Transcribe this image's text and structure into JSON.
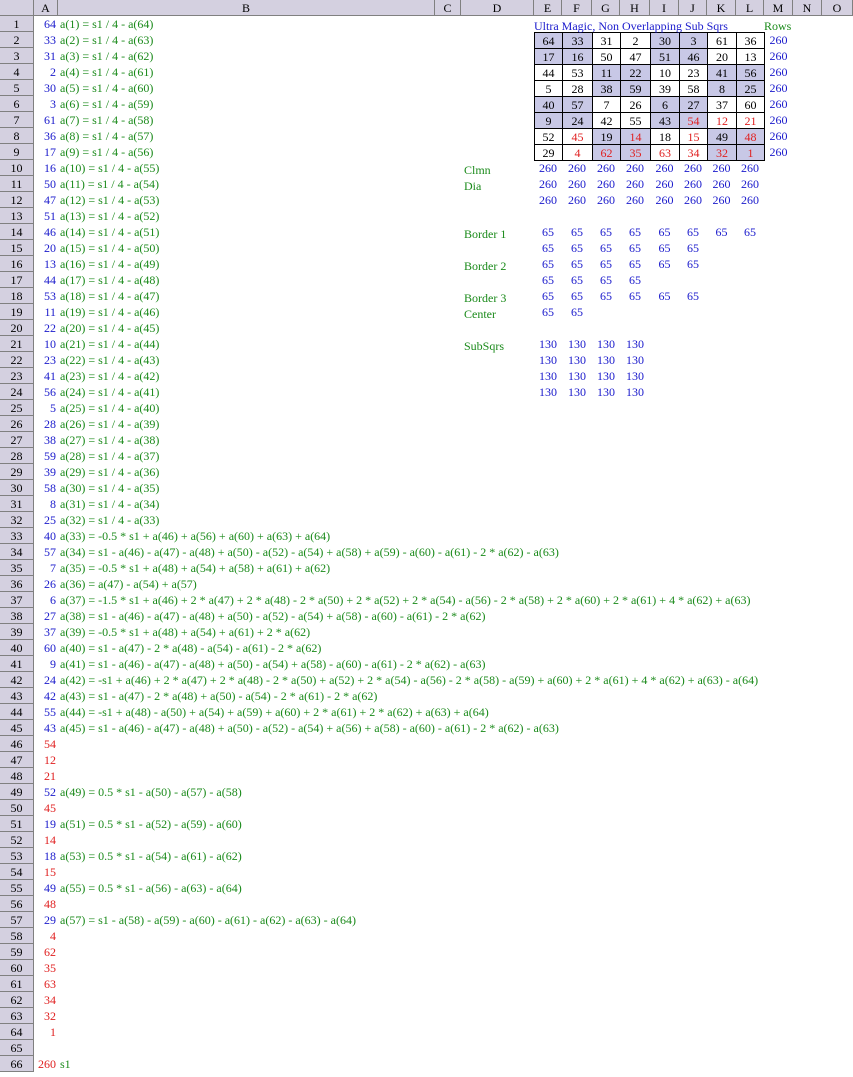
{
  "columns": [
    "A",
    "B",
    "C",
    "D",
    "E",
    "F",
    "G",
    "H",
    "I",
    "J",
    "K",
    "L",
    "M",
    "N",
    "O"
  ],
  "rows": [
    "1",
    "2",
    "3",
    "4",
    "5",
    "6",
    "7",
    "8",
    "9",
    "10",
    "11",
    "12",
    "13",
    "14",
    "15",
    "16",
    "17",
    "18",
    "19",
    "20",
    "21",
    "22",
    "23",
    "24",
    "25",
    "26",
    "27",
    "28",
    "29",
    "30",
    "31",
    "32",
    "33",
    "34",
    "35",
    "36",
    "37",
    "38",
    "39",
    "40",
    "41",
    "42",
    "43",
    "44",
    "45",
    "46",
    "47",
    "48",
    "49",
    "50",
    "51",
    "52",
    "53",
    "54",
    "55",
    "56",
    "57",
    "58",
    "59",
    "60",
    "61",
    "62",
    "63",
    "64",
    "65",
    "66"
  ],
  "colA": [
    {
      "v": "64",
      "c": "blue"
    },
    {
      "v": "33",
      "c": "blue"
    },
    {
      "v": "31",
      "c": "blue"
    },
    {
      "v": "2",
      "c": "blue"
    },
    {
      "v": "30",
      "c": "blue"
    },
    {
      "v": "3",
      "c": "blue"
    },
    {
      "v": "61",
      "c": "blue"
    },
    {
      "v": "36",
      "c": "blue"
    },
    {
      "v": "17",
      "c": "blue"
    },
    {
      "v": "16",
      "c": "blue"
    },
    {
      "v": "50",
      "c": "blue"
    },
    {
      "v": "47",
      "c": "blue"
    },
    {
      "v": "51",
      "c": "blue"
    },
    {
      "v": "46",
      "c": "blue"
    },
    {
      "v": "20",
      "c": "blue"
    },
    {
      "v": "13",
      "c": "blue"
    },
    {
      "v": "44",
      "c": "blue"
    },
    {
      "v": "53",
      "c": "blue"
    },
    {
      "v": "11",
      "c": "blue"
    },
    {
      "v": "22",
      "c": "blue"
    },
    {
      "v": "10",
      "c": "blue"
    },
    {
      "v": "23",
      "c": "blue"
    },
    {
      "v": "41",
      "c": "blue"
    },
    {
      "v": "56",
      "c": "blue"
    },
    {
      "v": "5",
      "c": "blue"
    },
    {
      "v": "28",
      "c": "blue"
    },
    {
      "v": "38",
      "c": "blue"
    },
    {
      "v": "59",
      "c": "blue"
    },
    {
      "v": "39",
      "c": "blue"
    },
    {
      "v": "58",
      "c": "blue"
    },
    {
      "v": "8",
      "c": "blue"
    },
    {
      "v": "25",
      "c": "blue"
    },
    {
      "v": "40",
      "c": "blue"
    },
    {
      "v": "57",
      "c": "blue"
    },
    {
      "v": "7",
      "c": "blue"
    },
    {
      "v": "26",
      "c": "blue"
    },
    {
      "v": "6",
      "c": "blue"
    },
    {
      "v": "27",
      "c": "blue"
    },
    {
      "v": "37",
      "c": "blue"
    },
    {
      "v": "60",
      "c": "blue"
    },
    {
      "v": "9",
      "c": "blue"
    },
    {
      "v": "24",
      "c": "blue"
    },
    {
      "v": "42",
      "c": "blue"
    },
    {
      "v": "55",
      "c": "blue"
    },
    {
      "v": "43",
      "c": "blue"
    },
    {
      "v": "54",
      "c": "red"
    },
    {
      "v": "12",
      "c": "red"
    },
    {
      "v": "21",
      "c": "red"
    },
    {
      "v": "52",
      "c": "blue"
    },
    {
      "v": "45",
      "c": "red"
    },
    {
      "v": "19",
      "c": "blue"
    },
    {
      "v": "14",
      "c": "red"
    },
    {
      "v": "18",
      "c": "blue"
    },
    {
      "v": "15",
      "c": "red"
    },
    {
      "v": "49",
      "c": "blue"
    },
    {
      "v": "48",
      "c": "red"
    },
    {
      "v": "29",
      "c": "blue"
    },
    {
      "v": "4",
      "c": "red"
    },
    {
      "v": "62",
      "c": "red"
    },
    {
      "v": "35",
      "c": "red"
    },
    {
      "v": "63",
      "c": "red"
    },
    {
      "v": "34",
      "c": "red"
    },
    {
      "v": "32",
      "c": "red"
    },
    {
      "v": "1",
      "c": "red"
    },
    {
      "v": "",
      "c": "blue"
    },
    {
      "v": "260",
      "c": "red"
    }
  ],
  "colB": [
    "a(1) = s1 / 4 - a(64)",
    "a(2) = s1 / 4 - a(63)",
    "a(3) = s1 / 4 - a(62)",
    "a(4) = s1 / 4 - a(61)",
    "a(5) = s1 / 4 - a(60)",
    "a(6) = s1 / 4 - a(59)",
    "a(7) = s1 / 4 - a(58)",
    "a(8) = s1 / 4 - a(57)",
    "a(9) = s1 / 4 - a(56)",
    "a(10) = s1 / 4 - a(55)",
    "a(11) = s1 / 4 - a(54)",
    "a(12) = s1 / 4 - a(53)",
    "a(13) = s1 / 4 - a(52)",
    "a(14) = s1 / 4 - a(51)",
    "a(15) = s1 / 4 - a(50)",
    "a(16) = s1 / 4 - a(49)",
    "a(17) = s1 / 4 - a(48)",
    "a(18) = s1 / 4 - a(47)",
    "a(19) = s1 / 4 - a(46)",
    "a(20) = s1 / 4 - a(45)",
    "a(21) = s1 / 4 - a(44)",
    "a(22) = s1 / 4 - a(43)",
    "a(23) = s1 / 4 - a(42)",
    "a(24) = s1 / 4 - a(41)",
    "a(25) = s1 / 4 - a(40)",
    "a(26) = s1 / 4 - a(39)",
    "a(27) = s1 / 4 - a(38)",
    "a(28) = s1 / 4 - a(37)",
    "a(29) = s1 / 4 - a(36)",
    "a(30) = s1 / 4 - a(35)",
    "a(31) = s1 / 4 - a(34)",
    "a(32) = s1 / 4 - a(33)",
    "a(33) = -0.5 * s1 + a(46) + a(56) + a(60) + a(63) + a(64)",
    "a(34) = s1 - a(46) - a(47) - a(48) + a(50) - a(52) - a(54) + a(58) + a(59) - a(60) - a(61) - 2 * a(62) - a(63)",
    "a(35) = -0.5 * s1 + a(48) + a(54) + a(58) + a(61) + a(62)",
    "a(36) = a(47) - a(54) + a(57)",
    "a(37) = -1.5 * s1 + a(46) + 2 * a(47) + 2 * a(48) - 2 * a(50) + 2 * a(52) + 2 * a(54) - a(56) - 2 * a(58) + 2 * a(60) + 2 * a(61) + 4 * a(62) + a(63)",
    "a(38) = s1 - a(46) - a(47) - a(48) + a(50) - a(52) - a(54) + a(58) - a(60) - a(61) - 2 * a(62)",
    "a(39) = -0.5 * s1 + a(48) + a(54) + a(61) + 2 * a(62)",
    "a(40) = s1 - a(47) - 2 * a(48) - a(54) - a(61) - 2 * a(62)",
    "a(41) = s1 - a(46) - a(47) - a(48) + a(50) - a(54) + a(58) - a(60) - a(61) - 2 * a(62) - a(63)",
    "a(42) = -s1 + a(46) + 2 * a(47) + 2 * a(48) - 2 * a(50) + a(52) + 2 * a(54) - a(56) - 2 * a(58) - a(59) + a(60) + 2 * a(61) + 4 * a(62) + a(63) - a(64)",
    "a(43) = s1 - a(47) - 2 * a(48) + a(50) - a(54) - 2 * a(61) - 2 * a(62)",
    "a(44) = -s1 + a(48) - a(50) + a(54) + a(59) + a(60) + 2 * a(61) + 2 * a(62) + a(63) + a(64)",
    "a(45) = s1 - a(46) - a(47) - a(48) + a(50) - a(52) - a(54) + a(56) + a(58) - a(60) - a(61) - 2 * a(62) - a(63)",
    "",
    "",
    "",
    "a(49) = 0.5 * s1 - a(50) - a(57) - a(58)",
    "",
    "a(51) = 0.5 * s1 - a(52) - a(59) - a(60)",
    "",
    "a(53) = 0.5 * s1 - a(54) - a(61) - a(62)",
    "",
    "a(55) = 0.5 * s1 - a(56) - a(63) - a(64)",
    "",
    "a(57) = s1 - a(58) - a(59) - a(60) - a(61) - a(62) - a(63) - a(64)",
    "",
    "",
    "",
    "",
    "",
    "",
    "",
    "",
    "s1"
  ],
  "square": {
    "title": "Ultra Magic, Non Overlapping Sub Sqrs",
    "rows_label": "Rows",
    "cells": [
      [
        {
          "v": "64",
          "s": 1,
          "c": "k"
        },
        {
          "v": "33",
          "s": 1,
          "c": "k"
        },
        {
          "v": "31",
          "s": 0,
          "c": "k"
        },
        {
          "v": "2",
          "s": 0,
          "c": "k"
        },
        {
          "v": "30",
          "s": 1,
          "c": "k"
        },
        {
          "v": "3",
          "s": 1,
          "c": "k"
        },
        {
          "v": "61",
          "s": 0,
          "c": "k"
        },
        {
          "v": "36",
          "s": 0,
          "c": "k"
        }
      ],
      [
        {
          "v": "17",
          "s": 1,
          "c": "k"
        },
        {
          "v": "16",
          "s": 1,
          "c": "k"
        },
        {
          "v": "50",
          "s": 0,
          "c": "k"
        },
        {
          "v": "47",
          "s": 0,
          "c": "k"
        },
        {
          "v": "51",
          "s": 1,
          "c": "k"
        },
        {
          "v": "46",
          "s": 1,
          "c": "k"
        },
        {
          "v": "20",
          "s": 0,
          "c": "k"
        },
        {
          "v": "13",
          "s": 0,
          "c": "k"
        }
      ],
      [
        {
          "v": "44",
          "s": 0,
          "c": "k"
        },
        {
          "v": "53",
          "s": 0,
          "c": "k"
        },
        {
          "v": "11",
          "s": 1,
          "c": "k"
        },
        {
          "v": "22",
          "s": 1,
          "c": "k"
        },
        {
          "v": "10",
          "s": 0,
          "c": "k"
        },
        {
          "v": "23",
          "s": 0,
          "c": "k"
        },
        {
          "v": "41",
          "s": 1,
          "c": "k"
        },
        {
          "v": "56",
          "s": 1,
          "c": "k"
        }
      ],
      [
        {
          "v": "5",
          "s": 0,
          "c": "k"
        },
        {
          "v": "28",
          "s": 0,
          "c": "k"
        },
        {
          "v": "38",
          "s": 1,
          "c": "k"
        },
        {
          "v": "59",
          "s": 1,
          "c": "k"
        },
        {
          "v": "39",
          "s": 0,
          "c": "k"
        },
        {
          "v": "58",
          "s": 0,
          "c": "k"
        },
        {
          "v": "8",
          "s": 1,
          "c": "k"
        },
        {
          "v": "25",
          "s": 1,
          "c": "k"
        }
      ],
      [
        {
          "v": "40",
          "s": 1,
          "c": "k"
        },
        {
          "v": "57",
          "s": 1,
          "c": "k"
        },
        {
          "v": "7",
          "s": 0,
          "c": "k"
        },
        {
          "v": "26",
          "s": 0,
          "c": "k"
        },
        {
          "v": "6",
          "s": 1,
          "c": "k"
        },
        {
          "v": "27",
          "s": 1,
          "c": "k"
        },
        {
          "v": "37",
          "s": 0,
          "c": "k"
        },
        {
          "v": "60",
          "s": 0,
          "c": "k"
        }
      ],
      [
        {
          "v": "9",
          "s": 1,
          "c": "k"
        },
        {
          "v": "24",
          "s": 1,
          "c": "k"
        },
        {
          "v": "42",
          "s": 0,
          "c": "k"
        },
        {
          "v": "55",
          "s": 0,
          "c": "k"
        },
        {
          "v": "43",
          "s": 1,
          "c": "k"
        },
        {
          "v": "54",
          "s": 1,
          "c": "r"
        },
        {
          "v": "12",
          "s": 0,
          "c": "r"
        },
        {
          "v": "21",
          "s": 0,
          "c": "r"
        }
      ],
      [
        {
          "v": "52",
          "s": 0,
          "c": "k"
        },
        {
          "v": "45",
          "s": 0,
          "c": "r"
        },
        {
          "v": "19",
          "s": 1,
          "c": "k"
        },
        {
          "v": "14",
          "s": 1,
          "c": "r"
        },
        {
          "v": "18",
          "s": 0,
          "c": "k"
        },
        {
          "v": "15",
          "s": 0,
          "c": "r"
        },
        {
          "v": "49",
          "s": 1,
          "c": "k"
        },
        {
          "v": "48",
          "s": 1,
          "c": "r"
        }
      ],
      [
        {
          "v": "29",
          "s": 0,
          "c": "k"
        },
        {
          "v": "4",
          "s": 0,
          "c": "r"
        },
        {
          "v": "62",
          "s": 1,
          "c": "r"
        },
        {
          "v": "35",
          "s": 1,
          "c": "r"
        },
        {
          "v": "63",
          "s": 0,
          "c": "r"
        },
        {
          "v": "34",
          "s": 0,
          "c": "r"
        },
        {
          "v": "32",
          "s": 1,
          "c": "r"
        },
        {
          "v": "1",
          "s": 1,
          "c": "r"
        }
      ]
    ],
    "row_sums": [
      "260",
      "260",
      "260",
      "260",
      "260",
      "260",
      "260",
      "260"
    ]
  },
  "labels": {
    "clmn": "Clmn",
    "dia": "Dia",
    "border1": "Border 1",
    "border2": "Border 2",
    "border3": "Border 3",
    "center": "Center",
    "subsqrs": "SubSqrs"
  },
  "summary_rows": [
    {
      "row": 10,
      "vals": [
        "260",
        "260",
        "260",
        "260",
        "260",
        "260",
        "260",
        "260"
      ]
    },
    {
      "row": 11,
      "vals": [
        "260",
        "260",
        "260",
        "260",
        "260",
        "260",
        "260",
        "260"
      ]
    },
    {
      "row": 12,
      "vals": [
        "260",
        "260",
        "260",
        "260",
        "260",
        "260",
        "260",
        "260"
      ]
    },
    {
      "row": 14,
      "vals": [
        "65",
        "65",
        "65",
        "65",
        "65",
        "65",
        "65",
        "65"
      ]
    },
    {
      "row": 15,
      "vals": [
        "65",
        "65",
        "65",
        "65",
        "65",
        "65"
      ]
    },
    {
      "row": 16,
      "vals": [
        "65",
        "65",
        "65",
        "65",
        "65",
        "65"
      ]
    },
    {
      "row": 17,
      "vals": [
        "65",
        "65",
        "65",
        "65"
      ]
    },
    {
      "row": 18,
      "vals": [
        "65",
        "65",
        "65",
        "65",
        "65",
        "65"
      ]
    },
    {
      "row": 19,
      "vals": [
        "65",
        "65"
      ]
    },
    {
      "row": 21,
      "vals": [
        "130",
        "130",
        "130",
        "130"
      ]
    },
    {
      "row": 22,
      "vals": [
        "130",
        "130",
        "130",
        "130"
      ]
    },
    {
      "row": 23,
      "vals": [
        "130",
        "130",
        "130",
        "130"
      ]
    },
    {
      "row": 24,
      "vals": [
        "130",
        "130",
        "130",
        "130"
      ]
    }
  ],
  "colors": {
    "blue": "#1a1acc",
    "green": "#1a8a1a",
    "red": "#e02020",
    "header": "#d4d0e0",
    "shade": "#c8c8e6"
  }
}
